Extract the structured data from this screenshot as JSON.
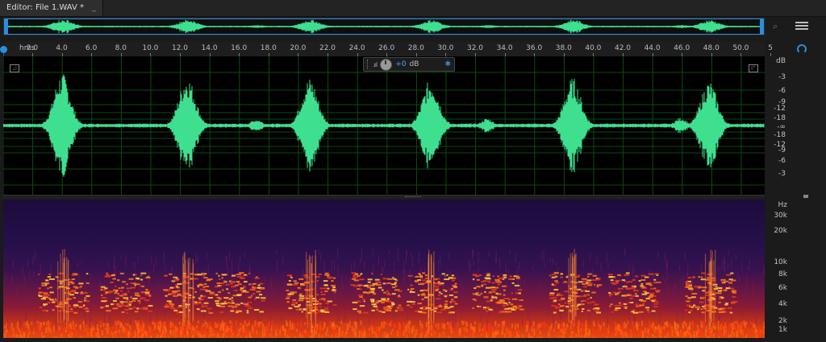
{
  "title_tab": {
    "label": "Editor: File 1.WAV *",
    "close": "_"
  },
  "toolbar": {
    "zoom_icon": "zoom-icon",
    "menu_icon": "hamburger-menu-icon"
  },
  "ruler": {
    "unit": "hms",
    "ticks": [
      "2.0",
      "4.0",
      "6.0",
      "8.0",
      "10.0",
      "12.0",
      "14.0",
      "16.0",
      "18.0",
      "20.0",
      "22.0",
      "24.0",
      "26.0",
      "28.0",
      "30.0",
      "32.0",
      "34.0",
      "36.0",
      "38.0",
      "40.0",
      "42.0",
      "44.0",
      "46.0",
      "48.0",
      "50.0",
      "5"
    ]
  },
  "hud": {
    "value": "+0",
    "unit": "dB"
  },
  "db_scale": {
    "labels": [
      "dB",
      "-3",
      "-6",
      "-9",
      "-12",
      "-18",
      "-∞",
      "-18",
      "-12",
      "-9",
      "-6",
      "-3"
    ]
  },
  "hz_scale": {
    "labels": [
      "Hz",
      "30k",
      "20k",
      "10k",
      "8k",
      "6k",
      "4k",
      "2k",
      "1k"
    ]
  },
  "colors": {
    "waveform": "#3ee08f",
    "accent": "#2a8de0",
    "grid": "#0d4a15"
  }
}
